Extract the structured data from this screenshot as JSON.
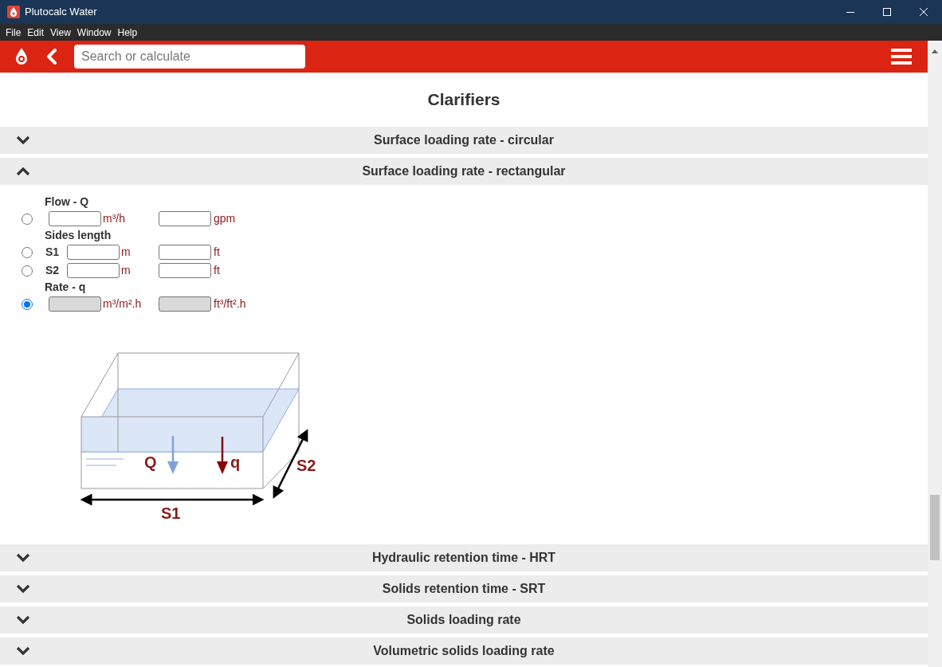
{
  "window": {
    "title": "Plutocalc Water"
  },
  "menu": [
    "File",
    "Edit",
    "View",
    "Window",
    "Help"
  ],
  "search": {
    "placeholder": "Search or calculate"
  },
  "page_title": "Clarifiers",
  "sections": [
    {
      "title": "Surface loading rate - circular",
      "expanded": false
    },
    {
      "title": "Surface loading rate - rectangular",
      "expanded": true,
      "form": [
        {
          "kind": "heading",
          "label": "Flow - Q"
        },
        {
          "kind": "input",
          "selected": false,
          "disabled": false,
          "unit_1": "m³/h",
          "unit_2": "gpm"
        },
        {
          "kind": "heading",
          "label": "Sides length"
        },
        {
          "kind": "input",
          "selected": false,
          "disabled": false,
          "symbol": "S1",
          "unit_1": "m",
          "unit_2": "ft"
        },
        {
          "kind": "input",
          "selected": false,
          "disabled": false,
          "symbol": "S2",
          "unit_1": "m",
          "unit_2": "ft"
        },
        {
          "kind": "heading",
          "label": "Rate - q"
        },
        {
          "kind": "input",
          "selected": true,
          "disabled": true,
          "unit_1": "m³/m².h",
          "unit_2": "ft³/ft².h"
        }
      ],
      "diagram": {
        "labels": [
          "Q",
          "q",
          "S2",
          "S1"
        ]
      }
    },
    {
      "title": "Hydraulic retention time - HRT",
      "expanded": false
    },
    {
      "title": "Solids retention time - SRT",
      "expanded": false
    },
    {
      "title": "Solids loading rate",
      "expanded": false
    },
    {
      "title": "Volumetric solids loading rate",
      "expanded": false
    }
  ]
}
